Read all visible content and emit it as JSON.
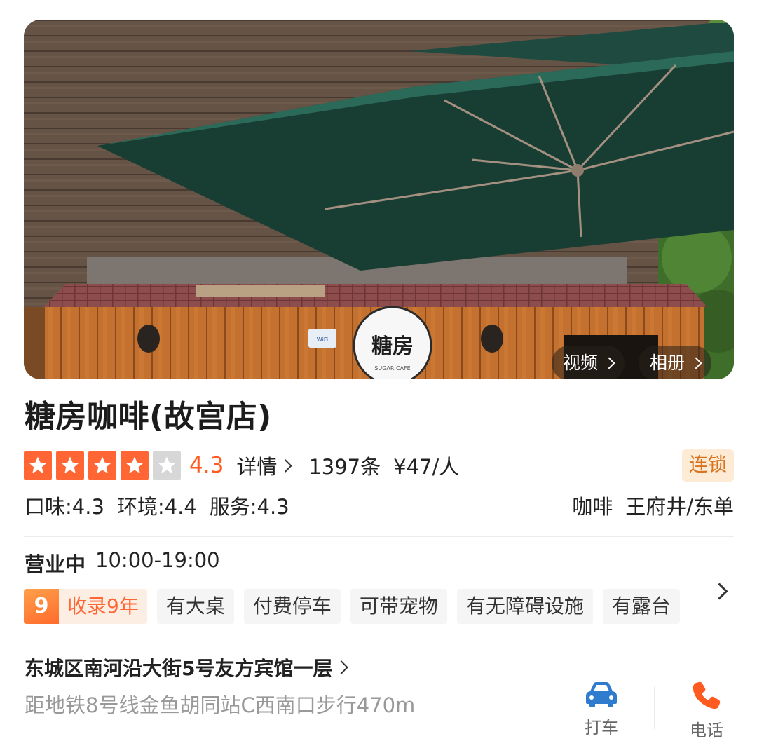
{
  "hero": {
    "video_label": "视频",
    "album_label": "相册",
    "sign_text": "糖房",
    "sign_subtext": "SUGAR CAFE",
    "wifi_text": "WiFi"
  },
  "shop": {
    "name": "糖房咖啡(故宫店)",
    "stars": 4,
    "rating": "4.3",
    "details_label": "详情",
    "review_count": "1397条",
    "price": "¥47/人",
    "chain_badge": "连锁",
    "sub_scores": [
      "口味:4.3",
      "环境:4.4",
      "服务:4.3"
    ],
    "category": "咖啡",
    "district": "王府井/东单"
  },
  "hours": {
    "status": "营业中",
    "time": "10:00-19:00"
  },
  "tags": {
    "years_number": "9",
    "years_label": "收录9年",
    "items": [
      "有大桌",
      "付费停车",
      "可带宠物",
      "有无障碍设施",
      "有露台"
    ]
  },
  "location": {
    "address": "东城区南河沿大街5号友方宾馆一层",
    "metro": "距地铁8号线金鱼胡同站C西南口步行470m"
  },
  "actions": {
    "taxi_label": "打车",
    "phone_label": "电话"
  },
  "colors": {
    "accent": "#ff6633",
    "chain_bg": "#fdebd5",
    "chain_text": "#d9731e",
    "taxi_icon": "#2f7ccf",
    "phone_icon": "#ff5a1f"
  }
}
